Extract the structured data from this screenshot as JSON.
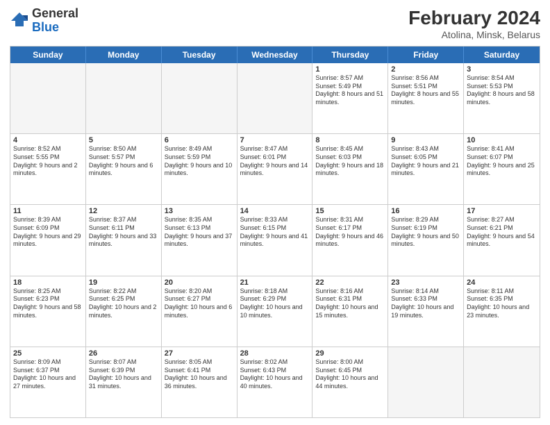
{
  "header": {
    "logo_general": "General",
    "logo_blue": "Blue",
    "title": "February 2024",
    "subtitle": "Atolina, Minsk, Belarus"
  },
  "calendar": {
    "days_of_week": [
      "Sunday",
      "Monday",
      "Tuesday",
      "Wednesday",
      "Thursday",
      "Friday",
      "Saturday"
    ],
    "weeks": [
      [
        {
          "day": "",
          "info": "",
          "empty": true
        },
        {
          "day": "",
          "info": "",
          "empty": true
        },
        {
          "day": "",
          "info": "",
          "empty": true
        },
        {
          "day": "",
          "info": "",
          "empty": true
        },
        {
          "day": "1",
          "info": "Sunrise: 8:57 AM\nSunset: 5:49 PM\nDaylight: 8 hours and 51 minutes."
        },
        {
          "day": "2",
          "info": "Sunrise: 8:56 AM\nSunset: 5:51 PM\nDaylight: 8 hours and 55 minutes."
        },
        {
          "day": "3",
          "info": "Sunrise: 8:54 AM\nSunset: 5:53 PM\nDaylight: 8 hours and 58 minutes."
        }
      ],
      [
        {
          "day": "4",
          "info": "Sunrise: 8:52 AM\nSunset: 5:55 PM\nDaylight: 9 hours and 2 minutes."
        },
        {
          "day": "5",
          "info": "Sunrise: 8:50 AM\nSunset: 5:57 PM\nDaylight: 9 hours and 6 minutes."
        },
        {
          "day": "6",
          "info": "Sunrise: 8:49 AM\nSunset: 5:59 PM\nDaylight: 9 hours and 10 minutes."
        },
        {
          "day": "7",
          "info": "Sunrise: 8:47 AM\nSunset: 6:01 PM\nDaylight: 9 hours and 14 minutes."
        },
        {
          "day": "8",
          "info": "Sunrise: 8:45 AM\nSunset: 6:03 PM\nDaylight: 9 hours and 18 minutes."
        },
        {
          "day": "9",
          "info": "Sunrise: 8:43 AM\nSunset: 6:05 PM\nDaylight: 9 hours and 21 minutes."
        },
        {
          "day": "10",
          "info": "Sunrise: 8:41 AM\nSunset: 6:07 PM\nDaylight: 9 hours and 25 minutes."
        }
      ],
      [
        {
          "day": "11",
          "info": "Sunrise: 8:39 AM\nSunset: 6:09 PM\nDaylight: 9 hours and 29 minutes."
        },
        {
          "day": "12",
          "info": "Sunrise: 8:37 AM\nSunset: 6:11 PM\nDaylight: 9 hours and 33 minutes."
        },
        {
          "day": "13",
          "info": "Sunrise: 8:35 AM\nSunset: 6:13 PM\nDaylight: 9 hours and 37 minutes."
        },
        {
          "day": "14",
          "info": "Sunrise: 8:33 AM\nSunset: 6:15 PM\nDaylight: 9 hours and 41 minutes."
        },
        {
          "day": "15",
          "info": "Sunrise: 8:31 AM\nSunset: 6:17 PM\nDaylight: 9 hours and 46 minutes."
        },
        {
          "day": "16",
          "info": "Sunrise: 8:29 AM\nSunset: 6:19 PM\nDaylight: 9 hours and 50 minutes."
        },
        {
          "day": "17",
          "info": "Sunrise: 8:27 AM\nSunset: 6:21 PM\nDaylight: 9 hours and 54 minutes."
        }
      ],
      [
        {
          "day": "18",
          "info": "Sunrise: 8:25 AM\nSunset: 6:23 PM\nDaylight: 9 hours and 58 minutes."
        },
        {
          "day": "19",
          "info": "Sunrise: 8:22 AM\nSunset: 6:25 PM\nDaylight: 10 hours and 2 minutes."
        },
        {
          "day": "20",
          "info": "Sunrise: 8:20 AM\nSunset: 6:27 PM\nDaylight: 10 hours and 6 minutes."
        },
        {
          "day": "21",
          "info": "Sunrise: 8:18 AM\nSunset: 6:29 PM\nDaylight: 10 hours and 10 minutes."
        },
        {
          "day": "22",
          "info": "Sunrise: 8:16 AM\nSunset: 6:31 PM\nDaylight: 10 hours and 15 minutes."
        },
        {
          "day": "23",
          "info": "Sunrise: 8:14 AM\nSunset: 6:33 PM\nDaylight: 10 hours and 19 minutes."
        },
        {
          "day": "24",
          "info": "Sunrise: 8:11 AM\nSunset: 6:35 PM\nDaylight: 10 hours and 23 minutes."
        }
      ],
      [
        {
          "day": "25",
          "info": "Sunrise: 8:09 AM\nSunset: 6:37 PM\nDaylight: 10 hours and 27 minutes."
        },
        {
          "day": "26",
          "info": "Sunrise: 8:07 AM\nSunset: 6:39 PM\nDaylight: 10 hours and 31 minutes."
        },
        {
          "day": "27",
          "info": "Sunrise: 8:05 AM\nSunset: 6:41 PM\nDaylight: 10 hours and 36 minutes."
        },
        {
          "day": "28",
          "info": "Sunrise: 8:02 AM\nSunset: 6:43 PM\nDaylight: 10 hours and 40 minutes."
        },
        {
          "day": "29",
          "info": "Sunrise: 8:00 AM\nSunset: 6:45 PM\nDaylight: 10 hours and 44 minutes."
        },
        {
          "day": "",
          "info": "",
          "empty": true
        },
        {
          "day": "",
          "info": "",
          "empty": true
        }
      ]
    ]
  }
}
